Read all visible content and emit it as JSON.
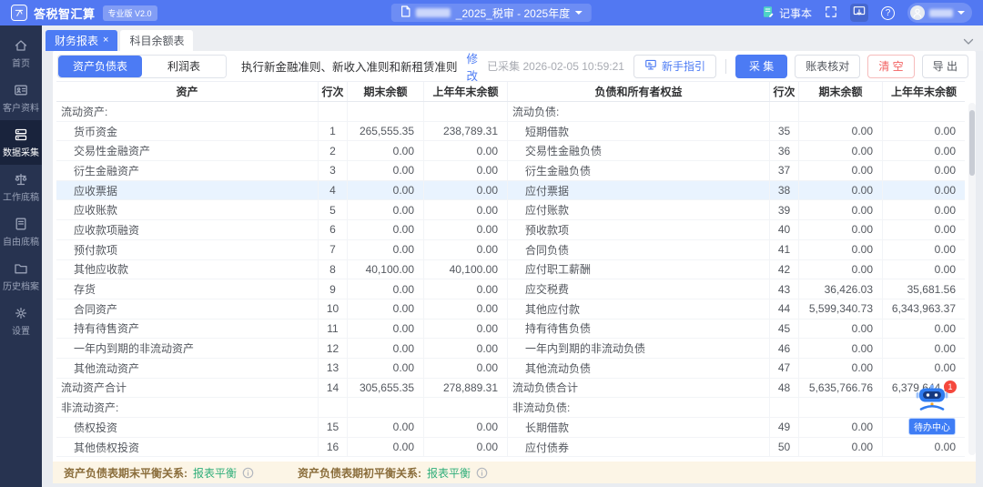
{
  "topbar": {
    "brand": "答税智汇算",
    "badge": "专业版 V2.0",
    "doc_title": "_2025_税审 - 2025年度",
    "notebook": "记事本"
  },
  "sidebar": {
    "items": [
      {
        "label": "首页",
        "icon": "home"
      },
      {
        "label": "客户资料",
        "icon": "id-card"
      },
      {
        "label": "数据采集",
        "icon": "database"
      },
      {
        "label": "工作底稿",
        "icon": "scale"
      },
      {
        "label": "自由底稿",
        "icon": "doc"
      },
      {
        "label": "历史档案",
        "icon": "folder"
      },
      {
        "label": "设置",
        "icon": "gear"
      }
    ]
  },
  "tabs": {
    "items": [
      {
        "label": "财务报表",
        "closable": true,
        "active": true
      },
      {
        "label": "科目余额表",
        "closable": false,
        "active": false
      }
    ]
  },
  "toolbar": {
    "segments": [
      {
        "label": "资产负债表",
        "active": true
      },
      {
        "label": "利润表",
        "active": false
      }
    ],
    "standards_text": "执行新金融准则、新收入准则和新租赁准则",
    "modify_link": "修改",
    "collected_status": "已采集 2026-02-05 10:59:21",
    "guide_button": "新手指引",
    "collect_button": "采 集",
    "check_button": "账表核对",
    "clear_button": "清 空",
    "export_button": "导 出"
  },
  "table": {
    "headers": [
      "资产",
      "行次",
      "期末余额",
      "上年年末余额",
      "负债和所有者权益",
      "行次",
      "期末余额",
      "上年年末余额"
    ],
    "rows": [
      {
        "kind": "section",
        "a": "流动资产:",
        "al": "",
        "ae": "",
        "ap": "",
        "b": "流动负债:",
        "bl": "",
        "be": "",
        "bp": "",
        "hl": false
      },
      {
        "kind": "item",
        "a": "货币资金",
        "al": "1",
        "ae": "265,555.35",
        "ap": "238,789.31",
        "b": "短期借款",
        "bl": "35",
        "be": "0.00",
        "bp": "0.00",
        "hl": false
      },
      {
        "kind": "item",
        "a": "交易性金融资产",
        "al": "2",
        "ae": "0.00",
        "ap": "0.00",
        "b": "交易性金融负债",
        "bl": "36",
        "be": "0.00",
        "bp": "0.00",
        "hl": false
      },
      {
        "kind": "item",
        "a": "衍生金融资产",
        "al": "3",
        "ae": "0.00",
        "ap": "0.00",
        "b": "衍生金融负债",
        "bl": "37",
        "be": "0.00",
        "bp": "0.00",
        "hl": false
      },
      {
        "kind": "item",
        "a": "应收票据",
        "al": "4",
        "ae": "0.00",
        "ap": "0.00",
        "b": "应付票据",
        "bl": "38",
        "be": "0.00",
        "bp": "0.00",
        "hl": true
      },
      {
        "kind": "item",
        "a": "应收账款",
        "al": "5",
        "ae": "0.00",
        "ap": "0.00",
        "b": "应付账款",
        "bl": "39",
        "be": "0.00",
        "bp": "0.00",
        "hl": false
      },
      {
        "kind": "item",
        "a": "应收款项融资",
        "al": "6",
        "ae": "0.00",
        "ap": "0.00",
        "b": "预收款项",
        "bl": "40",
        "be": "0.00",
        "bp": "0.00",
        "hl": false
      },
      {
        "kind": "item",
        "a": "预付款项",
        "al": "7",
        "ae": "0.00",
        "ap": "0.00",
        "b": "合同负债",
        "bl": "41",
        "be": "0.00",
        "bp": "0.00",
        "hl": false
      },
      {
        "kind": "item",
        "a": "其他应收款",
        "al": "8",
        "ae": "40,100.00",
        "ap": "40,100.00",
        "b": "应付职工薪酬",
        "bl": "42",
        "be": "0.00",
        "bp": "0.00",
        "hl": false
      },
      {
        "kind": "item",
        "a": "存货",
        "al": "9",
        "ae": "0.00",
        "ap": "0.00",
        "b": "应交税费",
        "bl": "43",
        "be": "36,426.03",
        "bp": "35,681.56",
        "hl": false
      },
      {
        "kind": "item",
        "a": "合同资产",
        "al": "10",
        "ae": "0.00",
        "ap": "0.00",
        "b": "其他应付款",
        "bl": "44",
        "be": "5,599,340.73",
        "bp": "6,343,963.37",
        "hl": false
      },
      {
        "kind": "item",
        "a": "持有待售资产",
        "al": "11",
        "ae": "0.00",
        "ap": "0.00",
        "b": "持有待售负债",
        "bl": "45",
        "be": "0.00",
        "bp": "0.00",
        "hl": false
      },
      {
        "kind": "item",
        "a": "一年内到期的非流动资产",
        "al": "12",
        "ae": "0.00",
        "ap": "0.00",
        "b": "一年内到期的非流动负债",
        "bl": "46",
        "be": "0.00",
        "bp": "0.00",
        "hl": false
      },
      {
        "kind": "item",
        "a": "其他流动资产",
        "al": "13",
        "ae": "0.00",
        "ap": "0.00",
        "b": "其他流动负债",
        "bl": "47",
        "be": "0.00",
        "bp": "0.00",
        "hl": false
      },
      {
        "kind": "total",
        "a": "流动资产合计",
        "al": "14",
        "ae": "305,655.35",
        "ap": "278,889.31",
        "b": "流动负债合计",
        "bl": "48",
        "be": "5,635,766.76",
        "bp": "6,379,644.93",
        "hl": false
      },
      {
        "kind": "section",
        "a": "非流动资产:",
        "al": "",
        "ae": "",
        "ap": "",
        "b": "非流动负债:",
        "bl": "",
        "be": "",
        "bp": "",
        "hl": false
      },
      {
        "kind": "item",
        "a": "债权投资",
        "al": "15",
        "ae": "0.00",
        "ap": "0.00",
        "b": "长期借款",
        "bl": "49",
        "be": "0.00",
        "bp": "0.00",
        "hl": false
      },
      {
        "kind": "item",
        "a": "其他债权投资",
        "al": "16",
        "ae": "0.00",
        "ap": "0.00",
        "b": "应付债券",
        "bl": "50",
        "be": "0.00",
        "bp": "0.00",
        "hl": false
      }
    ]
  },
  "footer": {
    "end_label": "资产负债表期末平衡关系:",
    "end_value": "报表平衡",
    "begin_label": "资产负债表期初平衡关系:",
    "begin_value": "报表平衡"
  },
  "floating": {
    "label": "待办中心",
    "badge": "1"
  },
  "colors": {
    "accent": "#4c7bf4",
    "topbar": "#5278f2",
    "sidebar": "#273350",
    "danger": "#f25f5f",
    "success": "#2fae79",
    "highlight_row": "#e9f3fe",
    "footer_bg": "#fcf5e6"
  }
}
